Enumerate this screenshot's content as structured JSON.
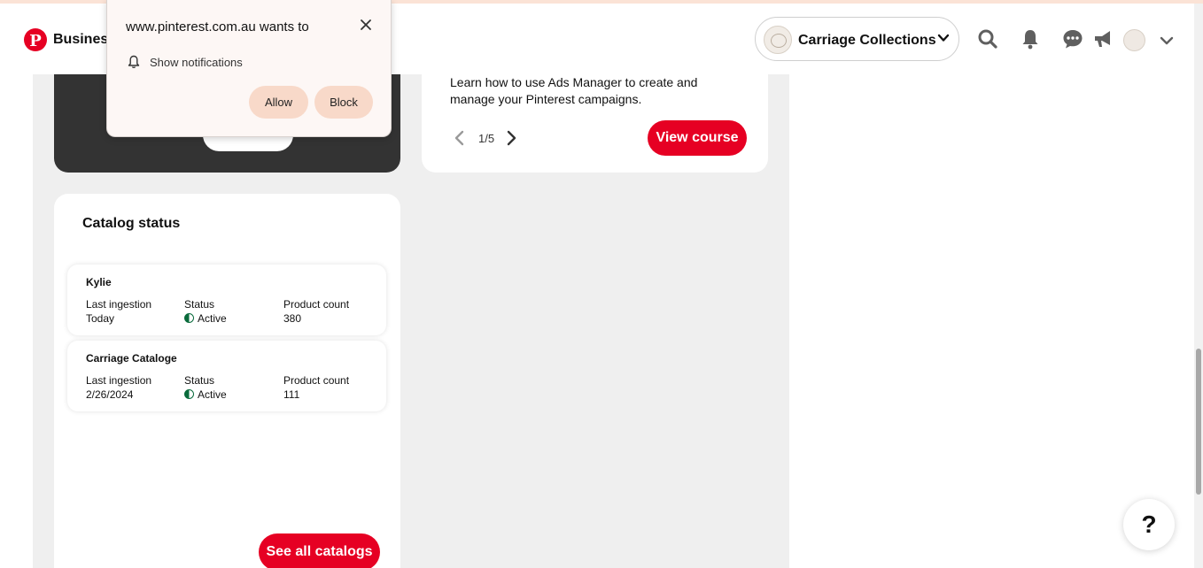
{
  "header": {
    "logo_text": "Business",
    "account_name": "Carriage Collections"
  },
  "ads_card": {
    "description": "Learn how to use Ads Manager to create and manage your Pinterest campaigns.",
    "page_indicator": "1/5",
    "cta_label": "View course"
  },
  "catalog": {
    "title": "Catalog status",
    "items": [
      {
        "name": "Kylie",
        "ingestion_label": "Last ingestion",
        "ingestion_value": "Today",
        "status_label": "Status",
        "status_value": "Active",
        "count_label": "Product count",
        "count_value": "380"
      },
      {
        "name": "Carriage Cataloge",
        "ingestion_label": "Last ingestion",
        "ingestion_value": "2/26/2024",
        "status_label": "Status",
        "status_value": "Active",
        "count_label": "Product count",
        "count_value": "111"
      }
    ],
    "see_all_label": "See all catalogs"
  },
  "notification_prompt": {
    "title": "www.pinterest.com.au wants to",
    "permission": "Show notifications",
    "allow_label": "Allow",
    "block_label": "Block"
  },
  "help": {
    "label": "?"
  },
  "colors": {
    "brand_red": "#e60023",
    "status_green": "#0a6b3c",
    "prompt_button": "#f8d9c9"
  },
  "icons": [
    "pinterest-logo-icon",
    "chevron-down-icon",
    "search-icon",
    "bell-icon",
    "chat-icon",
    "megaphone-icon",
    "chevron-left-icon",
    "chevron-right-icon",
    "close-icon",
    "status-active-icon"
  ]
}
